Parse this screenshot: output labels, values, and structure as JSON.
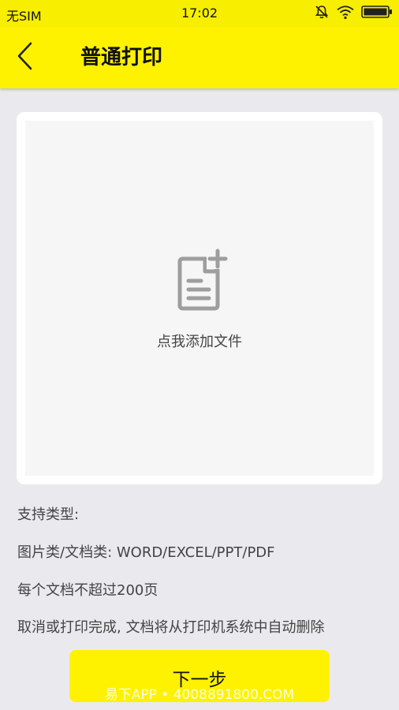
{
  "status_bar": {
    "carrier": "无SIM",
    "time": "17:02",
    "icons": [
      "mute-bell-icon",
      "wifi-icon",
      "battery-icon"
    ]
  },
  "header": {
    "back_icon": "chevron-left-icon",
    "title": "普通打印"
  },
  "upload": {
    "icon": "add-document-icon",
    "label": "点我添加文件"
  },
  "info": {
    "supported_types": "支持类型:",
    "file_types": "图片类/文档类: WORD/EXCEL/PPT/PDF",
    "page_limit": "每个文档不超过200页",
    "auto_delete": "取消或打印完成, 文档将从打印机系统中自动删除"
  },
  "footer": {
    "next_label": "下一步",
    "watermark": "易下APP • 4008891800.COM"
  },
  "colors": {
    "accent": "#fff200",
    "background": "#e9e9ee",
    "card": "#ffffff",
    "upload_area": "#f6f6f6",
    "icon_gray": "#9e9e9e"
  }
}
